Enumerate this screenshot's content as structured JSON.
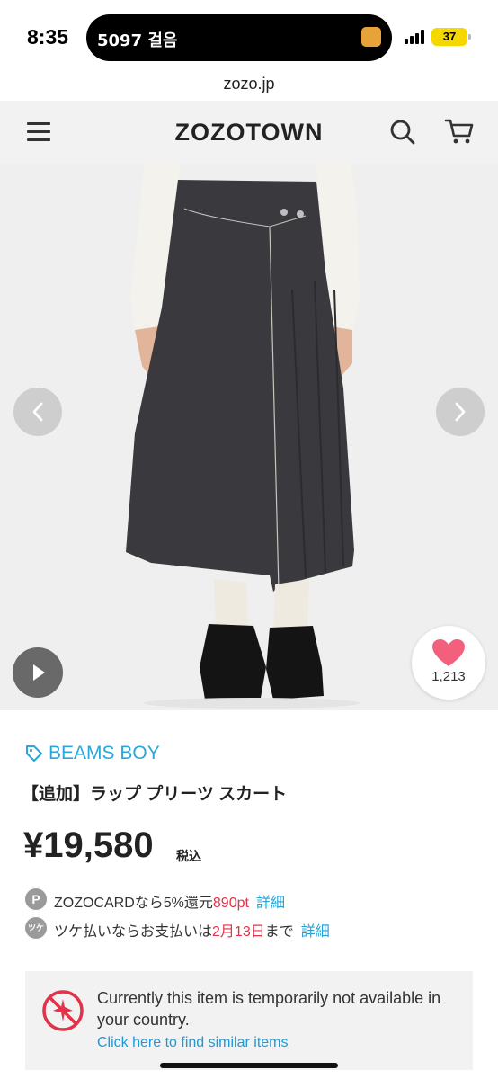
{
  "status_bar": {
    "time": "8:35",
    "activity": "5097 걸음",
    "battery": "37"
  },
  "browser": {
    "url": "zozo.jp"
  },
  "header": {
    "logo": "ZOZOTOWN"
  },
  "gallery": {
    "favorite_count": "1,213"
  },
  "product": {
    "brand": "BEAMS BOY",
    "name": "【追加】ラップ プリーツ スカート",
    "price": "¥19,580",
    "tax_label": "税込",
    "points_badge": "P",
    "points_text": "ZOZOCARDなら5%還元",
    "points_amount": "890pt",
    "points_detail": "詳細",
    "tsuke_badge": "ツケ",
    "tsuke_text_before": "ツケ払いならお支払いは",
    "tsuke_date": "2月13日",
    "tsuke_text_after": "まで",
    "tsuke_detail": "詳細"
  },
  "notice": {
    "message": "Currently this item is temporarily not available in your country.",
    "link": "Click here to find similar items"
  },
  "colors": {
    "accent_blue": "#28a8d8",
    "price_red": "#e0344a",
    "heart_pink": "#f2607e"
  }
}
